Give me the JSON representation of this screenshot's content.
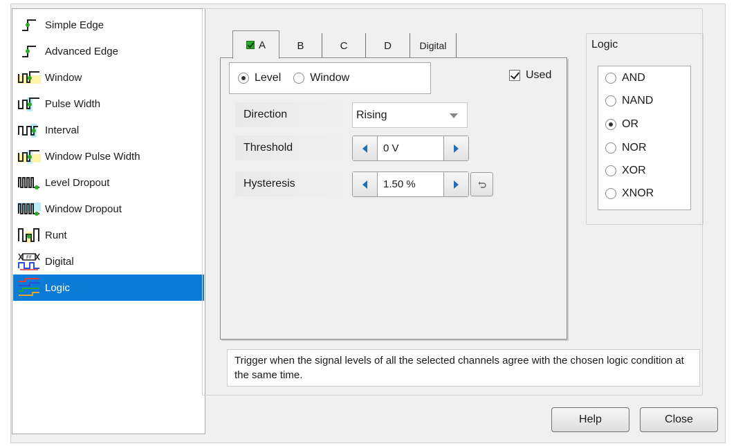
{
  "trigger_types": [
    {
      "label": "Simple Edge",
      "icon": "simple-edge-icon"
    },
    {
      "label": "Advanced Edge",
      "icon": "advanced-edge-icon"
    },
    {
      "label": "Window",
      "icon": "window-icon"
    },
    {
      "label": "Pulse Width",
      "icon": "pulse-width-icon"
    },
    {
      "label": "Interval",
      "icon": "interval-icon"
    },
    {
      "label": "Window Pulse Width",
      "icon": "window-pulse-width-icon"
    },
    {
      "label": "Level Dropout",
      "icon": "level-dropout-icon"
    },
    {
      "label": "Window Dropout",
      "icon": "window-dropout-icon"
    },
    {
      "label": "Runt",
      "icon": "runt-icon"
    },
    {
      "label": "Digital",
      "icon": "digital-icon"
    },
    {
      "label": "Logic",
      "icon": "logic-icon",
      "selected": true
    }
  ],
  "tabs": [
    {
      "label": "A",
      "active": true,
      "checked": true
    },
    {
      "label": "B"
    },
    {
      "label": "C"
    },
    {
      "label": "D"
    },
    {
      "label": "Digital"
    }
  ],
  "mode": {
    "options": [
      "Level",
      "Window"
    ],
    "selected": "Level"
  },
  "used": {
    "label": "Used",
    "checked": true
  },
  "direction": {
    "label": "Direction",
    "value": "Rising"
  },
  "threshold": {
    "label": "Threshold",
    "value": "0 V"
  },
  "hysteresis": {
    "label": "Hysteresis",
    "value": "1.50 %"
  },
  "logic": {
    "title": "Logic",
    "options": [
      "AND",
      "NAND",
      "OR",
      "NOR",
      "XOR",
      "XNOR"
    ],
    "selected": "OR"
  },
  "description": "Trigger when the signal levels of all the selected channels agree with the chosen logic condition at the same time.",
  "buttons": {
    "help": "Help",
    "close": "Close"
  },
  "colors": {
    "selection": "#0c7bd8",
    "signal_green": "#2ca82c",
    "spinner_arrow": "#1f6fb8",
    "window_fill": "#fff3a8",
    "dropout_fill": "#b8ecf7"
  }
}
